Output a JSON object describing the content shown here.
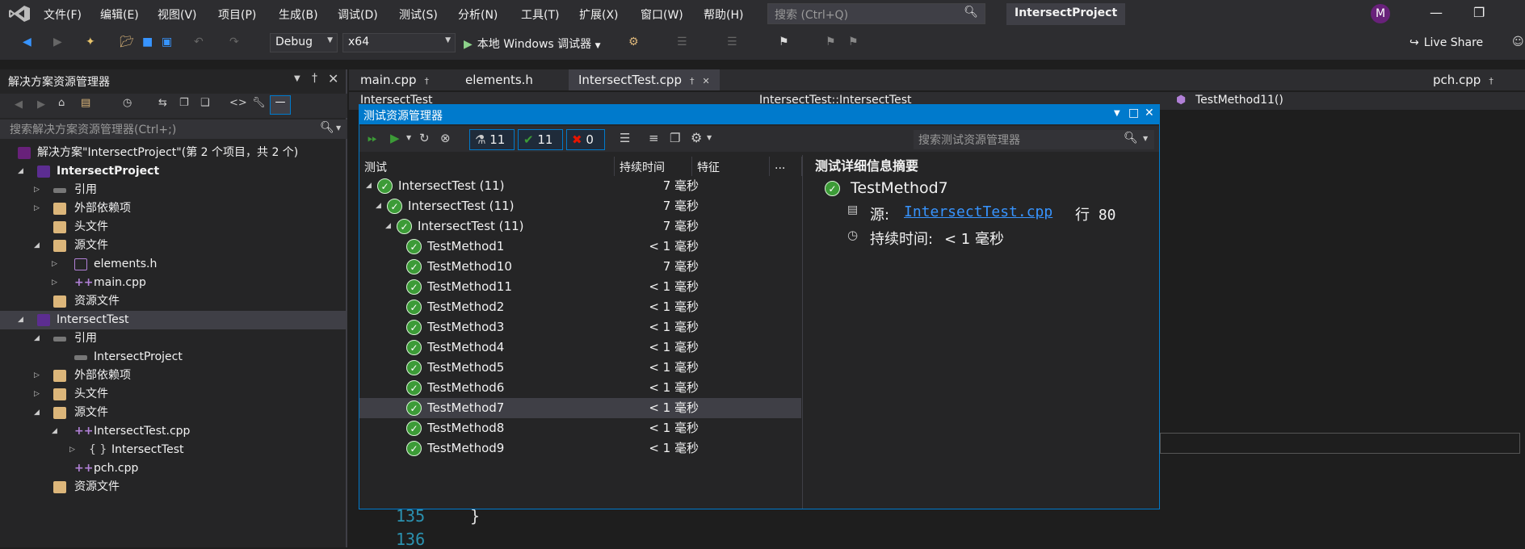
{
  "menubar": {
    "items": [
      "文件(F)",
      "编辑(E)",
      "视图(V)",
      "项目(P)",
      "生成(B)",
      "调试(D)",
      "测试(S)",
      "分析(N)",
      "工具(T)",
      "扩展(X)",
      "窗口(W)",
      "帮助(H)"
    ],
    "search_placeholder": "搜索 (Ctrl+Q)",
    "project_title": "IntersectProject",
    "avatar_initial": "M"
  },
  "toolbar": {
    "config": "Debug",
    "platform": "x64",
    "run_label": "本地 Windows 调试器",
    "live_share": "Live Share"
  },
  "solution_explorer": {
    "title": "解决方案资源管理器",
    "search_placeholder": "搜索解决方案资源管理器(Ctrl+;)",
    "solution_label": "解决方案\"IntersectProject\"(第 2 个项目，共 2 个)",
    "project1": "IntersectProject",
    "project2": "IntersectTest",
    "items": {
      "ref": "引用",
      "ext_deps": "外部依赖项",
      "headers": "头文件",
      "sources": "源文件",
      "elements_h": "elements.h",
      "main_cpp": "main.cpp",
      "resources": "资源文件",
      "ref_project": "IntersectProject",
      "intersecttest_cpp": "IntersectTest.cpp",
      "intersecttest_ns": "IntersectTest",
      "pch_cpp": "pch.cpp"
    }
  },
  "editor": {
    "tabs": [
      "main.cpp",
      "elements.h",
      "IntersectTest.cpp",
      "pch.cpp"
    ],
    "nav": {
      "project": "IntersectTest",
      "scope": "IntersectTest::IntersectTest",
      "member": "TestMethod11()"
    },
    "line_numbers": [
      "135",
      "136"
    ],
    "code_brace": "}"
  },
  "test_explorer": {
    "title": "测试资源管理器",
    "counts": {
      "total": "11",
      "passed": "11",
      "failed": "0"
    },
    "search_placeholder": "搜索测试资源管理器",
    "columns": {
      "test": "测试",
      "duration": "持续时间",
      "traits": "特征",
      "more": "..."
    },
    "rows": [
      {
        "name": "IntersectTest (11)",
        "duration": "7 毫秒"
      },
      {
        "name": "IntersectTest (11)",
        "duration": "7 毫秒"
      },
      {
        "name": "IntersectTest (11)",
        "duration": "7 毫秒"
      },
      {
        "name": "TestMethod1",
        "duration": "< 1 毫秒"
      },
      {
        "name": "TestMethod10",
        "duration": "7 毫秒"
      },
      {
        "name": "TestMethod11",
        "duration": "< 1 毫秒"
      },
      {
        "name": "TestMethod2",
        "duration": "< 1 毫秒"
      },
      {
        "name": "TestMethod3",
        "duration": "< 1 毫秒"
      },
      {
        "name": "TestMethod4",
        "duration": "< 1 毫秒"
      },
      {
        "name": "TestMethod5",
        "duration": "< 1 毫秒"
      },
      {
        "name": "TestMethod6",
        "duration": "< 1 毫秒"
      },
      {
        "name": "TestMethod7",
        "duration": "< 1 毫秒"
      },
      {
        "name": "TestMethod8",
        "duration": "< 1 毫秒"
      },
      {
        "name": "TestMethod9",
        "duration": "< 1 毫秒"
      }
    ],
    "detail": {
      "heading": "测试详细信息摘要",
      "test_name": "TestMethod7",
      "source_label": "源:",
      "source_link": "IntersectTest.cpp",
      "line_label": "行 80",
      "duration_label": "持续时间:",
      "duration_value": "< 1 毫秒"
    }
  },
  "colors": {
    "accent": "#007acc",
    "pass": "#3c9b37",
    "fail": "#e51400",
    "bg": "#1e1e1e",
    "chrome": "#2d2d30"
  }
}
